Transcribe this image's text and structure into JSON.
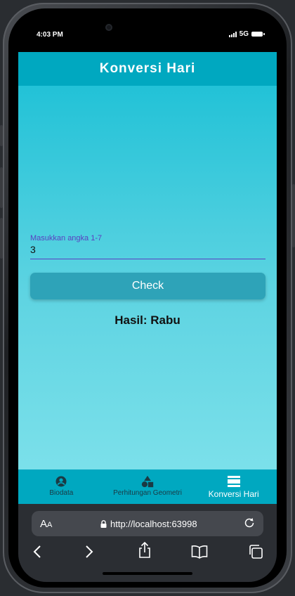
{
  "status": {
    "time": "4:03 PM",
    "network": "5G"
  },
  "app": {
    "title": "Konversi Hari"
  },
  "form": {
    "label": "Masukkan angka 1-7",
    "value": "3",
    "button_label": "Check",
    "result": "Hasil: Rabu"
  },
  "nav": {
    "items": [
      {
        "label": "Biodata",
        "icon": "account-circle-icon"
      },
      {
        "label": "Perhitungan Geometri",
        "icon": "shapes-icon"
      },
      {
        "label": "Konversi Hari",
        "icon": "view-agenda-icon",
        "active": true
      }
    ]
  },
  "browser": {
    "text_size_label": "AA",
    "url": "http://localhost:63998"
  },
  "colors": {
    "app_bar": "#00a8c0",
    "accent": "#5a3fc0",
    "button": "#2ea3b8"
  }
}
